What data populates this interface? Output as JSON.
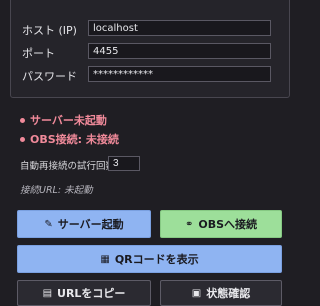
{
  "connection": {
    "host_label": "ホスト (IP)",
    "host_value": "localhost",
    "port_label": "ポート",
    "port_value": "4455",
    "password_label": "パスワード",
    "password_value": "************"
  },
  "status": {
    "server": "サーバー未起動",
    "obs": "OBS接続: 未接続",
    "status_color": "#f08a9a"
  },
  "retry": {
    "label": "自動再接続の試行回数:",
    "value": "3"
  },
  "url_text": "接続URL: 未起動",
  "buttons": {
    "start_server": "サーバー起動",
    "connect_obs": "OBSへ接続",
    "show_qr": "QRコードを表示",
    "copy_url": "URLをコピー",
    "check_status": "状態確認"
  },
  "icons": {
    "start_server": "rocket-icon",
    "connect_obs": "link-icon",
    "show_qr": "qr-icon",
    "copy_url": "document-icon",
    "check_status": "clipboard-icon"
  },
  "colors": {
    "primary_button": "#8fb4f2",
    "success_button": "#9ddf9a",
    "background": "#1f1e23"
  }
}
